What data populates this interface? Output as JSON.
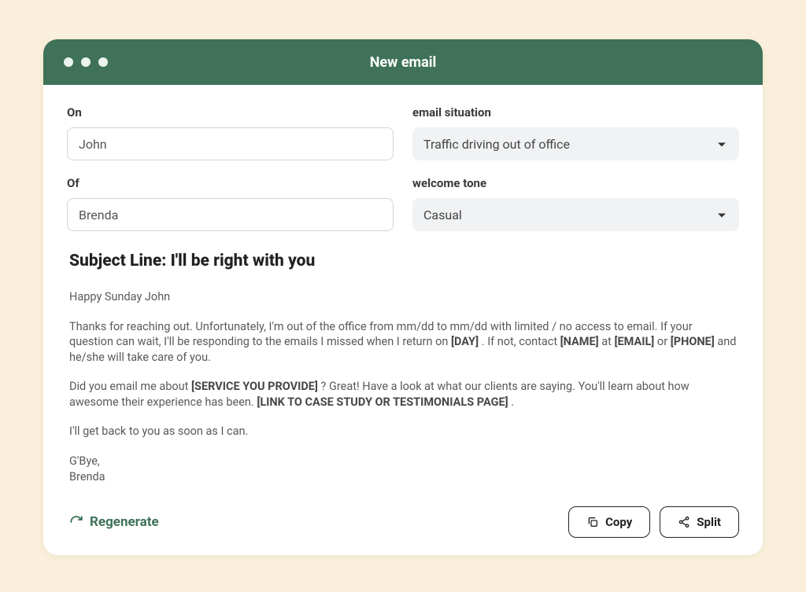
{
  "header": {
    "title": "New email"
  },
  "fields": {
    "on": {
      "label": "On",
      "value": "John"
    },
    "of": {
      "label": "Of",
      "value": "Brenda"
    },
    "situation": {
      "label": "email situation",
      "value": "Traffic driving out of office"
    },
    "tone": {
      "label": "welcome tone",
      "value": "Casual"
    }
  },
  "email": {
    "subject_prefix": "Subject Line: ",
    "subject": "I'll be right with you",
    "greeting": "Happy Sunday John",
    "p1_a": "Thanks for reaching out. Unfortunately, I'm out of the office from mm/dd to mm/dd with limited / no access to email. If your question can wait, I'll be responding to the emails I missed when I return on ",
    "p1_day": "[DAY]",
    "p1_b": " . If not, contact ",
    "p1_name": "[NAME]",
    "p1_c": " at ",
    "p1_email": "[EMAIL]",
    "p1_d": " or ",
    "p1_phone": "[PHONE]",
    "p1_e": " and he/she will take care of you.",
    "p2_a": "Did you email me about ",
    "p2_service": "[SERVICE YOU PROVIDE]",
    "p2_b": " ? Great! Have a look at what our clients are saying. You'll learn about how awesome their experience has been. ",
    "p2_link": "[LINK TO CASE STUDY OR TESTIMONIALS PAGE]",
    "p2_c": " .",
    "p3": "I'll get back to you as soon as I can.",
    "signoff": "G'Bye,",
    "sender": "Brenda"
  },
  "actions": {
    "regenerate": "Regenerate",
    "copy": "Copy",
    "split": "Split"
  }
}
